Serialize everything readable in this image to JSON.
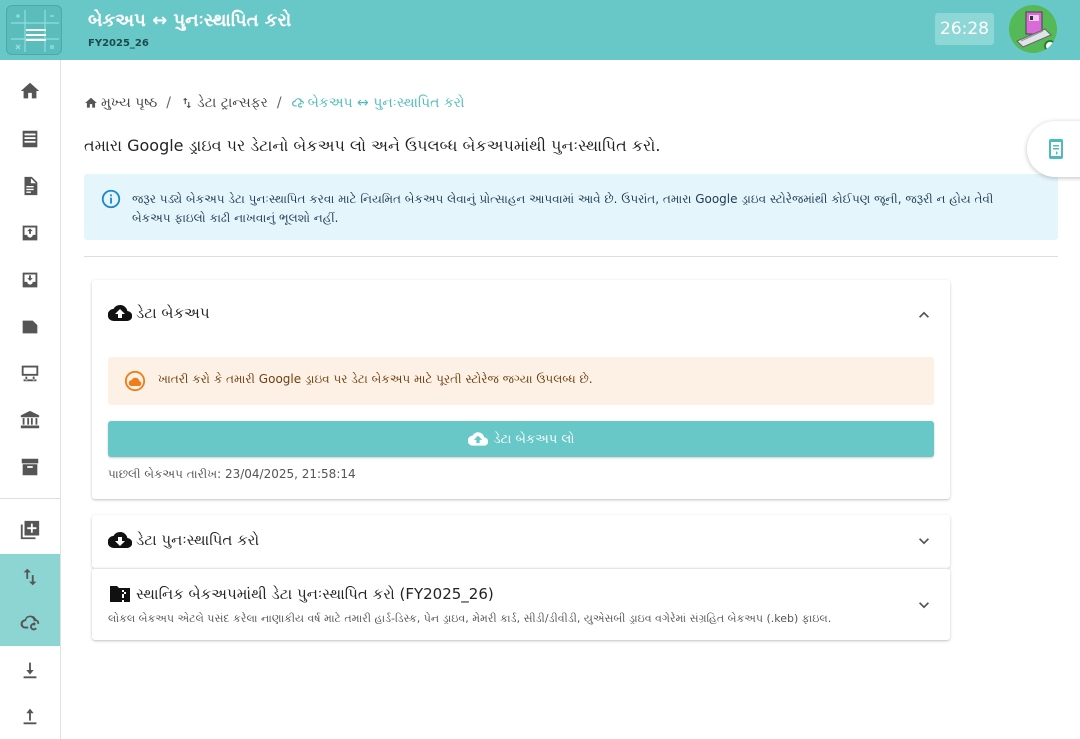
{
  "header": {
    "title": "બેકઅપ ↔ પુનઃસ્થાપિત કરો",
    "subtitle": "FY2025_26",
    "timer": "26:28",
    "menu_icon": "menu-icon",
    "accent_color": "#68c8c8"
  },
  "sidebar": {
    "items": [
      {
        "name": "home",
        "icon": "home-icon"
      },
      {
        "name": "list",
        "icon": "list-icon"
      },
      {
        "name": "document",
        "icon": "document-icon"
      },
      {
        "name": "inbox-in",
        "icon": "inbox-in-icon"
      },
      {
        "name": "inbox-out",
        "icon": "inbox-out-icon"
      },
      {
        "name": "label",
        "icon": "label-icon"
      },
      {
        "name": "store",
        "icon": "store-icon"
      },
      {
        "name": "bank",
        "icon": "bank-icon"
      },
      {
        "name": "archive",
        "icon": "archive-icon"
      },
      {
        "name": "library-add",
        "icon": "library-add-icon"
      },
      {
        "name": "data-transfer",
        "icon": "swap-vert-icon",
        "active": true
      },
      {
        "name": "backup-restore",
        "icon": "cloud-sync-icon",
        "active": true
      },
      {
        "name": "download",
        "icon": "download-icon"
      },
      {
        "name": "upload",
        "icon": "upload-icon"
      }
    ]
  },
  "breadcrumb": {
    "home": "મુખ્ય પૃષ્ઠ",
    "transfer": "ડેટા ટ્રાન્સફર",
    "current": "બેકઅપ ↔ પુનઃસ્થાપિત કરો"
  },
  "intro": "તમારા Google ડ્રાઇવ પર ડેટાનો બેકઅપ લો અને ઉપલબ્ધ બેકઅપમાંથી પુનઃસ્થાપિત કરો.",
  "info": {
    "text": "જરૂર પડ્યે બેકઅપ ડેટા પુનઃસ્થાપિત કરવા માટે નિયમિત બેકઅપ લેવાનું પ્રોત્સાહન આપવામાં આવે છે. ઉપરાંત, તમારા Google ડ્રાઇવ સ્ટોરેજમાંથી કોઈપણ જૂની, જરૂરી ન હોય તેવી બેકઅપ ફાઇલો કાઢી નાખવાનું ભૂલશો નહીં."
  },
  "backup_panel": {
    "title": "ડેટા બેકઅપ",
    "warning": "ખાતરી કરો કે તમારી Google ડ્રાઇવ પર ડેટા બેકઅપ માટે પૂરતી સ્ટોરેજ જગ્યા ઉપલબ્ધ છે.",
    "button": "ડેટા બેકઅપ લો",
    "last_backup": "પાછલી બેકઅપ તારીખ: 23/04/2025, 21:58:14"
  },
  "restore_panel": {
    "title": "ડેટા પુનઃસ્થાપિત કરો"
  },
  "local_panel": {
    "title": "સ્થાનિક બેકઅપમાંથી ડેટા પુનઃસ્થાપિત કરો (FY2025_26)",
    "subtitle": "લોકલ બેકઅપ એટલે પસંદ કરેલા નાણાકીય વર્ષ માટે તમારી હાર્ડ-ડિસ્ક, પેન ડ્રાઇવ, મેમરી કાર્ડ, સીડી/ડીવીડી, યુએસબી ડ્રાઇવ વગેરેમાં સંગ્રહિત બેકઅપ (.keb) ફાઇલ."
  }
}
